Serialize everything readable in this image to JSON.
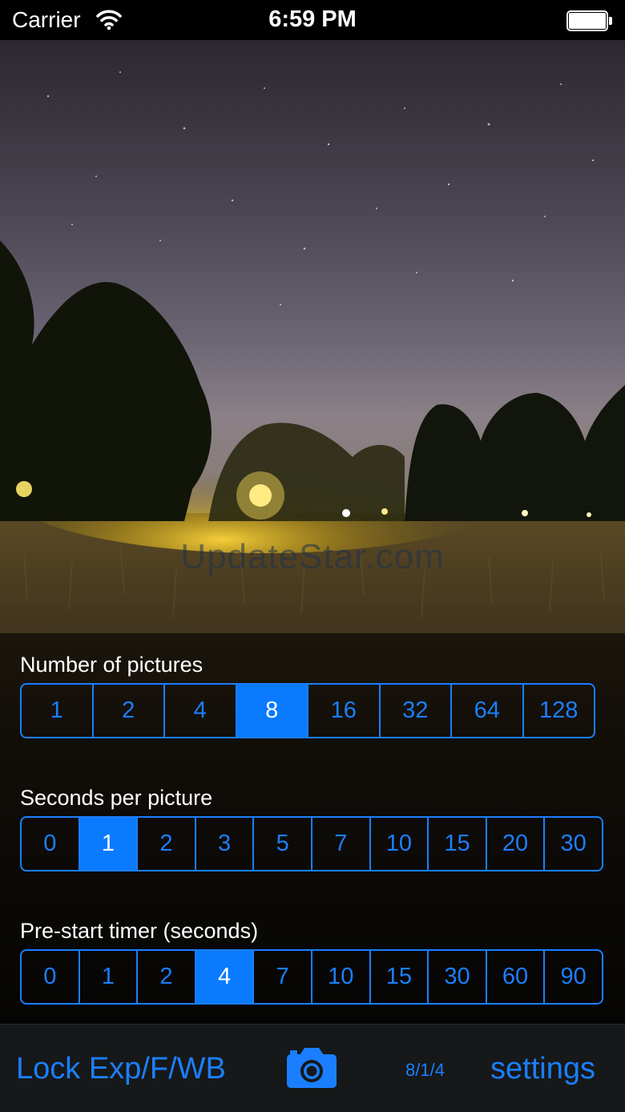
{
  "status_bar": {
    "carrier": "Carrier",
    "time": "6:59 PM",
    "icons": [
      "wifi-icon",
      "battery-icon"
    ]
  },
  "viewfinder": {
    "watermark": "UpdateStar.com"
  },
  "controls": {
    "number_of_pictures": {
      "label": "Number of pictures",
      "options": [
        "1",
        "2",
        "4",
        "8",
        "16",
        "32",
        "64",
        "128"
      ],
      "selected": "8"
    },
    "seconds_per_picture": {
      "label": "Seconds per picture",
      "options": [
        "0",
        "1",
        "2",
        "3",
        "5",
        "7",
        "10",
        "15",
        "20",
        "30"
      ],
      "selected": "1"
    },
    "prestart_timer": {
      "label": "Pre-start timer (seconds)",
      "options": [
        "0",
        "1",
        "2",
        "4",
        "7",
        "10",
        "15",
        "30",
        "60",
        "90"
      ],
      "selected": "4"
    }
  },
  "toolbar": {
    "lock_label": "Lock Exp/F/WB",
    "camera_icon": "camera-icon",
    "counter": "8/1/4",
    "settings_label": "settings"
  },
  "colors": {
    "accent": "#1a7fff",
    "selected_bg": "#0a7aff",
    "status_bar_bg": "#000000",
    "toolbar_bg": "#161819"
  }
}
